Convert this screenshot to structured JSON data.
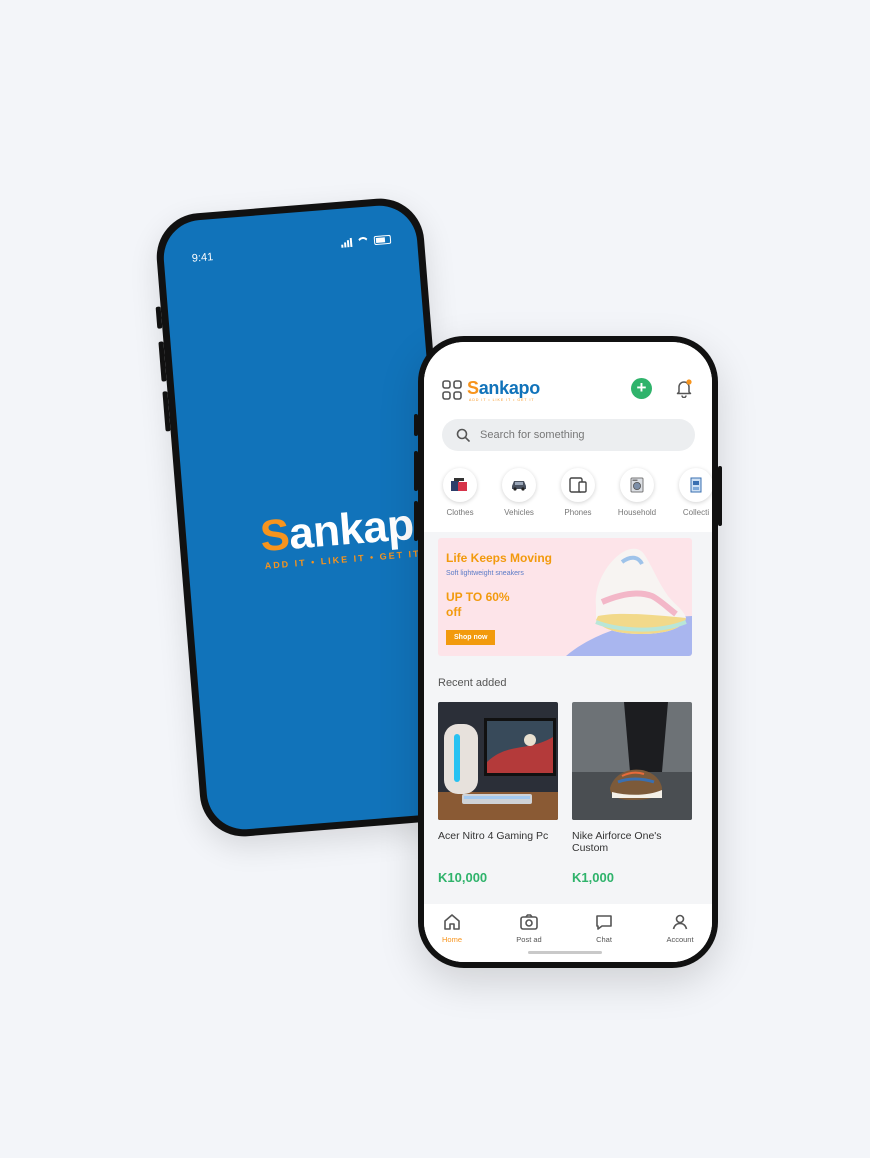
{
  "splash": {
    "time": "9:41",
    "brand_s": "S",
    "brand_rest": "ankapo",
    "tagline": "ADD IT • LIKE IT • GET IT"
  },
  "header": {
    "brand_s": "S",
    "brand_rest": "ankapo",
    "tagline": "ADD IT • LIKE IT • GET IT",
    "icons": [
      "grid-icon",
      "plus-icon",
      "bell-icon"
    ],
    "accent_green": "#2fb36b",
    "accent_orange": "#f7941d",
    "brand_blue": "#1173ba"
  },
  "search": {
    "placeholder": "Search for something"
  },
  "categories": [
    {
      "label": "Clothes",
      "icon": "clothes-icon"
    },
    {
      "label": "Vehicles",
      "icon": "car-icon"
    },
    {
      "label": "Phones",
      "icon": "phones-icon"
    },
    {
      "label": "Household",
      "icon": "washing-machine-icon"
    },
    {
      "label": "Collecti",
      "icon": "collectibles-icon"
    }
  ],
  "banner": {
    "title": "Life Keeps Moving",
    "subtitle": "Soft lightweight sneakers",
    "offer": "UP TO 60% off",
    "cta": "Shop now"
  },
  "recent": {
    "title": "Recent added",
    "items": [
      {
        "name": "Acer Nitro 4 Gaming Pc",
        "price": "K10,000"
      },
      {
        "name": "Nike Airforce One's Custom",
        "price": "K1,000"
      }
    ]
  },
  "nav": [
    {
      "label": "Home",
      "icon": "home-icon"
    },
    {
      "label": "Post ad",
      "icon": "camera-icon"
    },
    {
      "label": "Chat",
      "icon": "chat-icon"
    },
    {
      "label": "Account",
      "icon": "account-icon"
    }
  ]
}
